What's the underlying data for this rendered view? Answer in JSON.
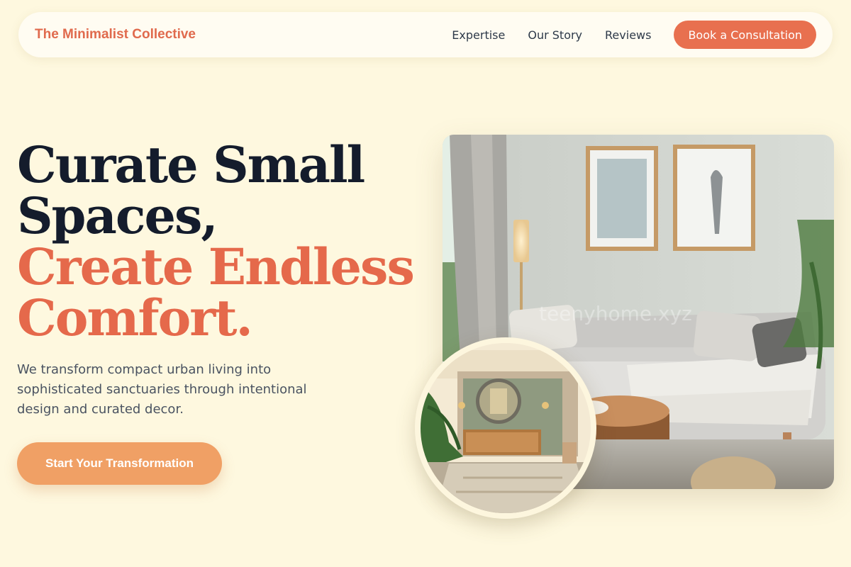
{
  "nav": {
    "brand": "The Minimalist Collective",
    "links": [
      "Expertise",
      "Our Story",
      "Reviews"
    ],
    "cta": "Book a Consultation"
  },
  "hero": {
    "title_line1": "Curate Small",
    "title_line2": "Spaces,",
    "title_line3": "Create Endless",
    "title_line4": "Comfort.",
    "description": "We transform compact urban living into sophisticated sanctuaries through intentional design and curated decor.",
    "button": "Start Your Transformation"
  },
  "images": {
    "watermark": "teenyhome.xyz"
  },
  "colors": {
    "background": "#fef8df",
    "accent": "#e5694b",
    "button_primary": "#f0a065",
    "heading_dark": "#141c2c"
  }
}
